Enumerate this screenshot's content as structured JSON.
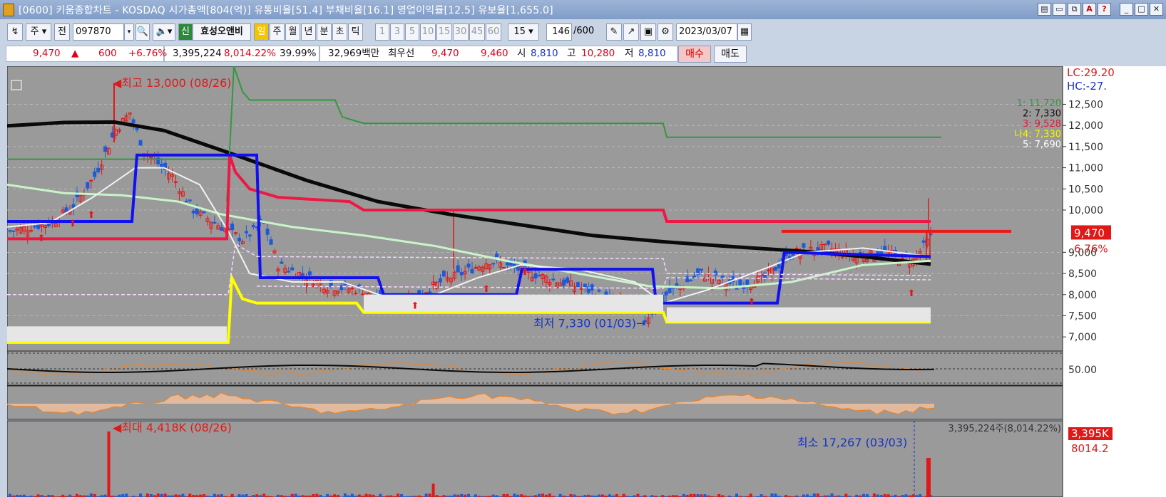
{
  "window": {
    "title": "[0600] 키움종합차트 - KOSDAQ 시가총액[804(억)] 유통비율[51.4] 부채비율[16.1] 영업이익률[12.5] 유보율[1,655.0]"
  },
  "toolbar": {
    "period_select": "주",
    "prev_label": "전",
    "code": "097870",
    "stock_name": "효성오앤비",
    "credit_badge": "신",
    "periods": [
      "일",
      "주",
      "월",
      "년",
      "분",
      "초",
      "틱"
    ],
    "selected_period": "일",
    "minute_buttons": [
      "1",
      "3",
      "5",
      "10",
      "15",
      "30",
      "45",
      "60"
    ],
    "minute_select": "15",
    "count": "146",
    "max_count": "/600",
    "date": "2023/03/07"
  },
  "quote": {
    "price": "9,470",
    "change_arrow": "▲",
    "change": "600",
    "change_pct": "+6.76%",
    "volume": "3,395,224",
    "volume_ratio": "8,014.22%",
    "turnover": "39.99%",
    "amount": "32,969백만",
    "best_label": "최우선",
    "ask": "9,470",
    "bid": "9,460",
    "open_label": "시",
    "open": "8,810",
    "high_label": "고",
    "high": "10,280",
    "low_label": "저",
    "low": "8,810",
    "buy": "매수",
    "sell": "매도"
  },
  "chart_labels": {
    "high_note": "최고 13,000 (08/26)",
    "low_note": "최저 7,330 (01/03)",
    "vol_max_note": "최대 4,418K (08/26)",
    "vol_min_note": "최소 17,267 (03/03)",
    "lc": "LC:29.20",
    "hc": "HC:-27.",
    "price_tag": "9,470",
    "pct_tag": "6.76%",
    "stoch_axis": "50.00",
    "vol_tag": "3,395K",
    "vol_ratio_tag": "8014.2",
    "vol_header": "3,395,224주(8,014.22%)",
    "legend": [
      {
        "text": "1: 11,720",
        "color": "#2f9a3f"
      },
      {
        "text": "2: 7,330",
        "color": "#111111"
      },
      {
        "text": "3: 9,528",
        "color": "#e5173a"
      },
      {
        "text": "나4: 7,330",
        "color": "#f5f500"
      },
      {
        "text": "5: 7,690",
        "color": "#ffffff"
      }
    ]
  },
  "chart_data": {
    "type": "candlestick",
    "price_axis": [
      12500,
      12000,
      11500,
      11000,
      10500,
      10000,
      9000,
      8500,
      8000,
      7500,
      7000
    ],
    "price_axis_labels": [
      "12,500",
      "12,000",
      "11,500",
      "11,000",
      "10,500",
      "10,000",
      "9,000",
      "8,500",
      "8,000",
      "7,500",
      "7,000"
    ],
    "ylim": [
      6700,
      13400
    ],
    "colors": {
      "up": "#e01818",
      "down": "#1e5ad8",
      "panel_bg": "#9a9a9a"
    }
  }
}
